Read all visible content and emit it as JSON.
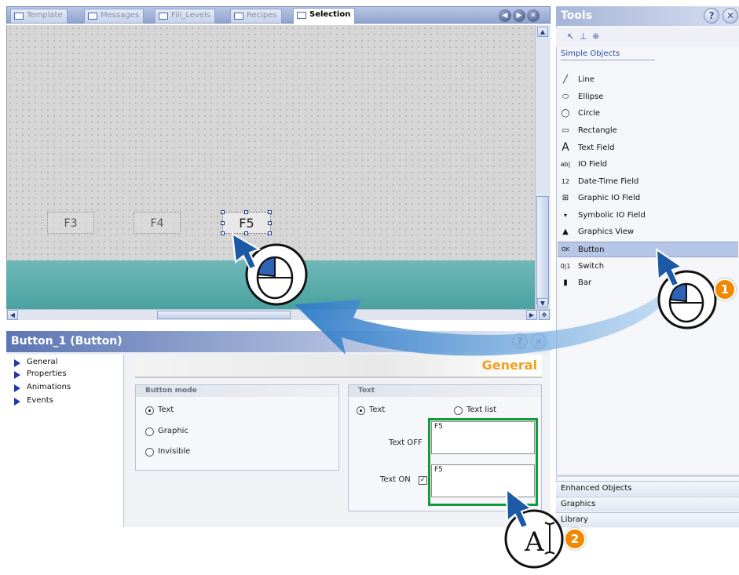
{
  "tabs": [
    {
      "label": "Template",
      "active": false
    },
    {
      "label": "Messages",
      "active": false
    },
    {
      "label": "Fill_Levels",
      "active": false
    },
    {
      "label": "Recipes",
      "active": false
    },
    {
      "label": "Selection",
      "active": true
    }
  ],
  "canvas": {
    "keys": [
      "F3",
      "F4",
      "F5"
    ]
  },
  "properties": {
    "title": "Button_1 (Button)",
    "tree": [
      "General",
      "Properties",
      "Animations",
      "Events"
    ],
    "section_title": "General",
    "button_mode": {
      "heading": "Button mode",
      "options": [
        "Text",
        "Graphic",
        "Invisible"
      ],
      "selected": "Text"
    },
    "text_group": {
      "heading": "Text",
      "options": [
        "Text",
        "Text list"
      ],
      "selected": "Text",
      "text_off_label": "Text OFF",
      "text_off_value": "F5",
      "text_on_label": "Text ON",
      "text_on_value": "F5",
      "text_on_checked": true
    }
  },
  "tools": {
    "title": "Tools",
    "section": "Simple Objects",
    "items": [
      {
        "label": "Line",
        "icon": "line-icon"
      },
      {
        "label": "Ellipse",
        "icon": "ellipse-icon"
      },
      {
        "label": "Circle",
        "icon": "circle-icon"
      },
      {
        "label": "Rectangle",
        "icon": "rectangle-icon"
      },
      {
        "label": "Text Field",
        "icon": "text-field-icon"
      },
      {
        "label": "IO Field",
        "icon": "io-field-icon"
      },
      {
        "label": "Date-Time Field",
        "icon": "date-time-icon"
      },
      {
        "label": "Graphic IO Field",
        "icon": "graphic-io-icon"
      },
      {
        "label": "Symbolic IO Field",
        "icon": "symbolic-io-icon"
      },
      {
        "label": "Graphics View",
        "icon": "graphics-view-icon"
      },
      {
        "label": "Button",
        "icon": "button-icon",
        "highlighted": true
      },
      {
        "label": "Switch",
        "icon": "switch-icon"
      },
      {
        "label": "Bar",
        "icon": "bar-icon"
      }
    ],
    "accordions": [
      "Enhanced Objects",
      "Graphics",
      "Library"
    ]
  },
  "steps": [
    "1",
    "2"
  ],
  "colors": {
    "accent": "#ef8a00",
    "highlight_box": "#129a3b",
    "teal": "#5aacab",
    "section_title": "#f0a020"
  }
}
